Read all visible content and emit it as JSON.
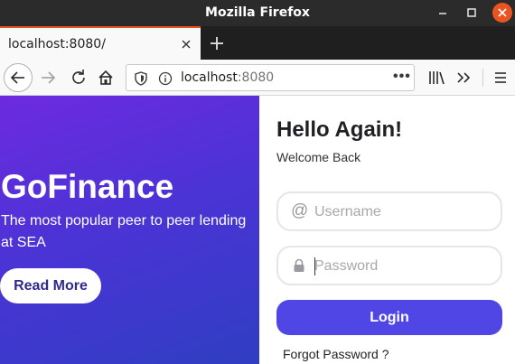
{
  "window": {
    "title": "Mozilla Firefox"
  },
  "tab": {
    "label": "localhost:8080/"
  },
  "urlbar": {
    "host": "localhost",
    "port": ":8080",
    "more": "•••"
  },
  "hero": {
    "brand": "GoFinance",
    "tagline": "The most popular peer to peer lending at SEA",
    "read_more": "Read More"
  },
  "form": {
    "heading": "Hello Again!",
    "subheading": "Welcome Back",
    "username_placeholder": "Username",
    "password_placeholder": "Password",
    "login_label": "Login",
    "forgot_label": "Forgot Password ?"
  },
  "colors": {
    "accent": "#4f46e5",
    "hero_gradient_start": "#6d2adf",
    "hero_gradient_end": "#2f3ec2",
    "close_button": "#e95420"
  },
  "icons": [
    "minimize-icon",
    "maximize-icon",
    "close-icon",
    "tab-close-icon",
    "plus-icon",
    "back-arrow-icon",
    "forward-arrow-icon",
    "reload-icon",
    "home-icon",
    "shield-icon",
    "info-icon",
    "library-icon",
    "overflow-chevron-icon",
    "hamburger-menu-icon",
    "at-icon",
    "lock-icon"
  ]
}
